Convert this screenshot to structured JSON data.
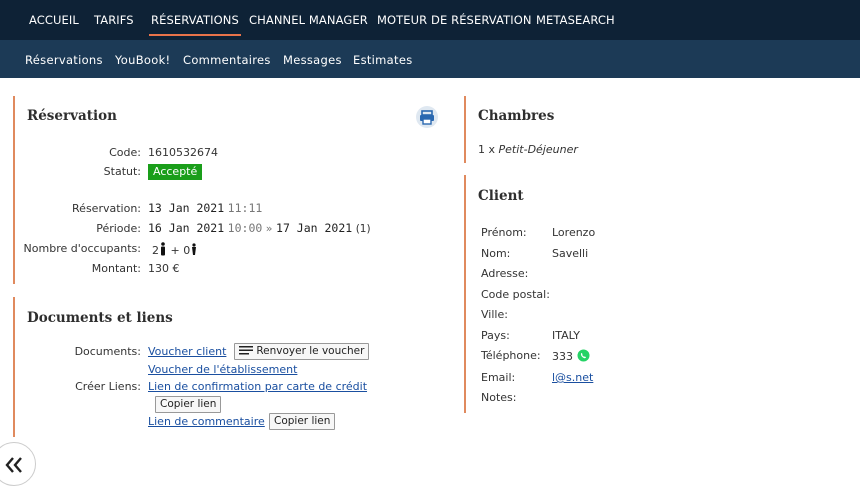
{
  "topnav": {
    "items": [
      {
        "label": "ACCUEIL"
      },
      {
        "label": "TARIFS"
      },
      {
        "label": "RÉSERVATIONS"
      },
      {
        "label": "CHANNEL MANAGER"
      },
      {
        "label": "MOTEUR DE RÉSERVATION"
      },
      {
        "label": "METASEARCH"
      }
    ],
    "active_index": 2
  },
  "subnav": {
    "items": [
      {
        "label": "Réservations"
      },
      {
        "label": "YouBook!"
      },
      {
        "label": "Commentaires"
      },
      {
        "label": "Messages"
      },
      {
        "label": "Estimates"
      }
    ]
  },
  "reservation": {
    "title": "Réservation",
    "code_label": "Code:",
    "code": "1610532674",
    "status_label": "Statut:",
    "status": "Accepté",
    "reservation_label": "Réservation:",
    "reservation_date": "13 Jan 2021",
    "reservation_time": "11:11",
    "period_label": "Période:",
    "period_start_date": "16 Jan 2021",
    "period_start_time": "10:00",
    "period_arrow": "»",
    "period_end_date": "17 Jan 2021",
    "period_nights": "(1)",
    "occupants_label": "Nombre d'occupants:",
    "adults": "2",
    "plus": "+",
    "children": "0",
    "amount_label": "Montant:",
    "amount": "130 €"
  },
  "documents": {
    "title": "Documents et liens",
    "documents_label": "Documents:",
    "voucher_client": "Voucher client",
    "resend_voucher": "Renvoyer le voucher",
    "voucher_establishment": "Voucher de l'établissement",
    "create_links_label": "Créer Liens:",
    "credit_card_link": "Lien de confirmation par carte de crédit",
    "copy_link_1": "Copier lien",
    "comment_link": "Lien de commentaire",
    "copy_link_2": "Copier lien"
  },
  "rooms": {
    "title": "Chambres",
    "quantity": "1 x",
    "room_name": "Petit-Déjeuner"
  },
  "client": {
    "title": "Client",
    "firstname_label": "Prénom:",
    "firstname": "Lorenzo",
    "lastname_label": "Nom:",
    "lastname": "Savelli",
    "address_label": "Adresse:",
    "postcode_label": "Code postal:",
    "city_label": "Ville:",
    "country_label": "Pays:",
    "country": "ITALY",
    "phone_label": "Téléphone:",
    "phone": "333",
    "email_label": "Email:",
    "email": "l@s.net",
    "notes_label": "Notes:"
  },
  "colors": {
    "topnav_bg": "#0e2236",
    "subnav_bg": "#1c3a56",
    "accent": "#e08a5e",
    "status_green": "#1a9e1a",
    "link_blue": "#1a4fa0",
    "whatsapp_green": "#25d366"
  },
  "icons": {
    "print": "print-icon",
    "person": "person-icon",
    "child": "child-icon",
    "lines": "lines-icon",
    "whatsapp": "whatsapp-icon",
    "back": "double-chevron-left-icon"
  }
}
